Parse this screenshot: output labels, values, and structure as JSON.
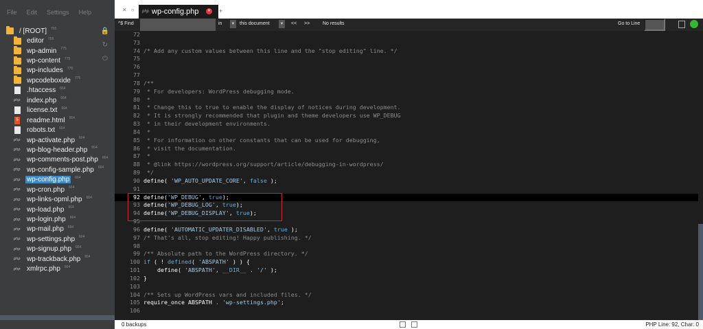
{
  "menu": [
    "File",
    "Edit",
    "Settings",
    "Help"
  ],
  "tree": [
    {
      "type": "folder",
      "name": "/ [ROOT]",
      "count": "755",
      "root": true
    },
    {
      "type": "folder",
      "name": "editor",
      "count": "755"
    },
    {
      "type": "folder",
      "name": "wp-admin",
      "count": "775"
    },
    {
      "type": "folder",
      "name": "wp-content",
      "count": "775"
    },
    {
      "type": "folder",
      "name": "wp-includes",
      "count": "775"
    },
    {
      "type": "folder",
      "name": "wpcodeboxide",
      "count": "775"
    },
    {
      "type": "file",
      "name": ".htaccess",
      "count": "664"
    },
    {
      "type": "php",
      "name": "index.php",
      "count": "664"
    },
    {
      "type": "file",
      "name": "license.txt",
      "count": "664"
    },
    {
      "type": "html",
      "name": "readme.html",
      "count": "664"
    },
    {
      "type": "file",
      "name": "robots.txt",
      "count": "664"
    },
    {
      "type": "php",
      "name": "wp-activate.php",
      "count": "664"
    },
    {
      "type": "php",
      "name": "wp-blog-header.php",
      "count": "664"
    },
    {
      "type": "php",
      "name": "wp-comments-post.php",
      "count": "664"
    },
    {
      "type": "php",
      "name": "wp-config-sample.php",
      "count": "664"
    },
    {
      "type": "php",
      "name": "wp-config.php",
      "count": "664",
      "selected": true
    },
    {
      "type": "php",
      "name": "wp-cron.php",
      "count": "664"
    },
    {
      "type": "php",
      "name": "wp-links-opml.php",
      "count": "664"
    },
    {
      "type": "php",
      "name": "wp-load.php",
      "count": "664"
    },
    {
      "type": "php",
      "name": "wp-login.php",
      "count": "664"
    },
    {
      "type": "php",
      "name": "wp-mail.php",
      "count": "664"
    },
    {
      "type": "php",
      "name": "wp-settings.php",
      "count": "664"
    },
    {
      "type": "php",
      "name": "wp-signup.php",
      "count": "664"
    },
    {
      "type": "php",
      "name": "wp-trackback.php",
      "count": "664"
    },
    {
      "type": "php",
      "name": "xmlrpc.php",
      "count": "664"
    }
  ],
  "icons": {
    "lock": "lock-icon",
    "refresh": "refresh-icon",
    "plug": "plug-icon",
    "tab_php": "php"
  },
  "tabs": {
    "active": "wp-config.php",
    "add": "+"
  },
  "findbar": {
    "find_label": "^$  Find",
    "find_value": "",
    "in_label": "in",
    "scope": "this document",
    "prev": "<<",
    "next": ">>",
    "results": "No results",
    "goto_label": "Go to Line",
    "goto_value": ""
  },
  "code": [
    {
      "n": "72",
      "t": ""
    },
    {
      "n": "73",
      "t": ""
    },
    {
      "n": "74",
      "t": "/* Add any custom values between this line and the \"stop editing\" line. */",
      "c": "cm"
    },
    {
      "n": "75",
      "t": ""
    },
    {
      "n": "76",
      "t": ""
    },
    {
      "n": "77",
      "t": ""
    },
    {
      "n": "78",
      "t": "/**",
      "c": "cm"
    },
    {
      "n": "79",
      "t": " * For developers: WordPress debugging mode.",
      "c": "cm"
    },
    {
      "n": "80",
      "t": " *",
      "c": "cm"
    },
    {
      "n": "81",
      "t": " * Change this to true to enable the display of notices during development.",
      "c": "cm"
    },
    {
      "n": "82",
      "t": " * It is strongly recommended that plugin and theme developers use WP_DEBUG",
      "c": "cm"
    },
    {
      "n": "83",
      "t": " * in their development environments.",
      "c": "cm"
    },
    {
      "n": "84",
      "t": " *",
      "c": "cm"
    },
    {
      "n": "85",
      "t": " * For information on other constants that can be used for debugging,",
      "c": "cm"
    },
    {
      "n": "86",
      "t": " * visit the documentation.",
      "c": "cm"
    },
    {
      "n": "87",
      "t": " *",
      "c": "cm"
    },
    {
      "n": "88",
      "t": " * @link https://wordpress.org/support/article/debugging-in-wordpress/",
      "c": "cm"
    },
    {
      "n": "89",
      "t": " */",
      "c": "cm"
    },
    {
      "n": "90",
      "parts": [
        [
          "define( ",
          "fn"
        ],
        [
          "'WP_AUTO_UPDATE_CORE'",
          "st"
        ],
        [
          ", ",
          "fn"
        ],
        [
          "false",
          "kw"
        ],
        [
          " );",
          "fn"
        ]
      ]
    },
    {
      "n": "91",
      "t": ""
    },
    {
      "n": "92",
      "active": true,
      "parts": [
        [
          "define(",
          "fn"
        ],
        [
          "'WP_DEBUG'",
          "st"
        ],
        [
          ", ",
          "fn"
        ],
        [
          "true",
          "kw"
        ],
        [
          ");",
          "fn"
        ]
      ]
    },
    {
      "n": "93",
      "parts": [
        [
          "define(",
          "fn"
        ],
        [
          "'WP_DEBUG_LOG'",
          "st"
        ],
        [
          ", ",
          "fn"
        ],
        [
          "true",
          "kw"
        ],
        [
          ");",
          "fn"
        ]
      ]
    },
    {
      "n": "94",
      "parts": [
        [
          "define(",
          "fn"
        ],
        [
          "'WP_DEBUG_DISPLAY'",
          "st"
        ],
        [
          ", ",
          "fn"
        ],
        [
          "true",
          "kw"
        ],
        [
          ");",
          "fn"
        ]
      ]
    },
    {
      "n": "95",
      "t": ""
    },
    {
      "n": "96",
      "parts": [
        [
          "define( ",
          "fn"
        ],
        [
          "'AUTOMATIC_UPDATER_DISABLED'",
          "st"
        ],
        [
          ", ",
          "fn"
        ],
        [
          "true",
          "kw"
        ],
        [
          " );",
          "fn"
        ]
      ]
    },
    {
      "n": "97",
      "t": "/* That's all, stop editing! Happy publishing. */",
      "c": "cm"
    },
    {
      "n": "98",
      "t": ""
    },
    {
      "n": "99",
      "t": "/** Absolute path to the WordPress directory. */",
      "c": "cm"
    },
    {
      "n": "100",
      "parts": [
        [
          "if",
          "kw"
        ],
        [
          " ( ! ",
          "fn"
        ],
        [
          "defined",
          "kw"
        ],
        [
          "( ",
          "fn"
        ],
        [
          "'ABSPATH'",
          "st"
        ],
        [
          " ) ) {",
          "fn"
        ]
      ]
    },
    {
      "n": "101",
      "parts": [
        [
          "    define( ",
          "fn"
        ],
        [
          "'ABSPATH'",
          "st"
        ],
        [
          ", ",
          "fn"
        ],
        [
          "__DIR__",
          "kw"
        ],
        [
          " . ",
          "fn"
        ],
        [
          "'/'",
          "st"
        ],
        [
          " );",
          "fn"
        ]
      ]
    },
    {
      "n": "102",
      "t": "}",
      "c": "fn"
    },
    {
      "n": "103",
      "t": ""
    },
    {
      "n": "104",
      "t": "/** Sets up WordPress vars and included files. */",
      "c": "cm"
    },
    {
      "n": "105",
      "parts": [
        [
          "require_once",
          "fn"
        ],
        [
          " ABSPATH . ",
          "fn"
        ],
        [
          "'wp-settings.php'",
          "st"
        ],
        [
          ";",
          "fn"
        ]
      ]
    },
    {
      "n": "106",
      "t": ""
    }
  ],
  "statusbar": {
    "left": "0 backups",
    "right": "PHP  Line: 92, Char: 0"
  },
  "colors": {
    "accent": "#3e89c8",
    "folder": "#f2b33c",
    "highlight": "#c9282d",
    "close": "#e0383e",
    "bug": "#36b836"
  }
}
